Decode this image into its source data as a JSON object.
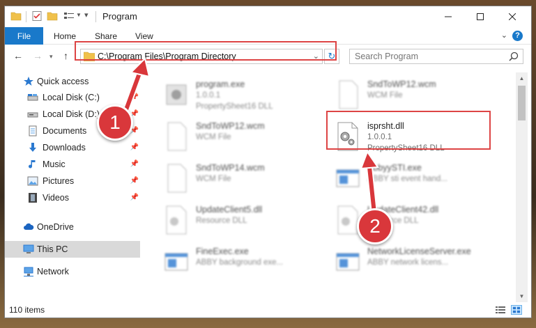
{
  "window": {
    "title": "Program",
    "colors": {
      "accent": "#1979ca",
      "highlight": "#dd4444",
      "selection": "#cce8ff"
    }
  },
  "ribbon": {
    "file": "File",
    "home": "Home",
    "share": "Share",
    "view": "View",
    "help": "?"
  },
  "nav": {
    "address": "C:\\Program Files\\Program Directory",
    "search_placeholder": "Search Program"
  },
  "sidebar": {
    "items": [
      {
        "label": "Quick access",
        "icon": "star-icon"
      },
      {
        "label": "Local Disk (C:)",
        "icon": "drive-icon",
        "pinned": true
      },
      {
        "label": "Local Disk (D:)",
        "icon": "drive-icon",
        "pinned": true
      },
      {
        "label": "Documents",
        "icon": "documents-icon",
        "pinned": true
      },
      {
        "label": "Downloads",
        "icon": "download-arrow-icon",
        "pinned": true
      },
      {
        "label": "Music",
        "icon": "music-note-icon",
        "pinned": true
      },
      {
        "label": "Pictures",
        "icon": "pictures-icon",
        "pinned": true
      },
      {
        "label": "Videos",
        "icon": "film-icon",
        "pinned": true
      },
      {
        "label": "OneDrive",
        "icon": "cloud-icon"
      },
      {
        "label": "This PC",
        "icon": "monitor-icon"
      },
      {
        "label": "Network",
        "icon": "network-icon"
      }
    ]
  },
  "files": [
    {
      "name": "program.exe",
      "ver": "1.0.0.1",
      "desc": "PropertySheet16 DLL",
      "icon": "exe-icon"
    },
    {
      "name": "SndToWP12.wcm",
      "ver": "WCM File",
      "desc": "",
      "icon": "blank-file-icon"
    },
    {
      "name": "SndToWP12.wcm",
      "ver": "WCM File",
      "desc": "",
      "icon": "blank-file-icon"
    },
    {
      "name": "isprsht.dll",
      "ver": "1.0.0.1",
      "desc": "PropertySheet16 DLL",
      "icon": "dll-gear-icon"
    },
    {
      "name": "SndToWP14.wcm",
      "ver": "WCM File",
      "desc": "",
      "icon": "blank-file-icon"
    },
    {
      "name": "AbbyySTI.exe",
      "ver": "ABBY sti event hand...",
      "desc": "",
      "icon": "exe-window-icon"
    },
    {
      "name": "UpdateClient5.dll",
      "ver": "Resource DLL",
      "desc": "",
      "icon": "dll-gear-icon"
    },
    {
      "name": "UpdateClient42.dll",
      "ver": "Resource DLL",
      "desc": "",
      "icon": "dll-gear-icon"
    },
    {
      "name": "FineExec.exe",
      "ver": "ABBY background exe...",
      "desc": "",
      "icon": "exe-window-icon"
    },
    {
      "name": "NetworkLicenseServer.exe",
      "ver": "ABBY network licens...",
      "desc": "",
      "icon": "exe-window-icon"
    }
  ],
  "status": {
    "item_count": "110 items"
  },
  "annotations": {
    "step1": "1",
    "step2": "2"
  }
}
